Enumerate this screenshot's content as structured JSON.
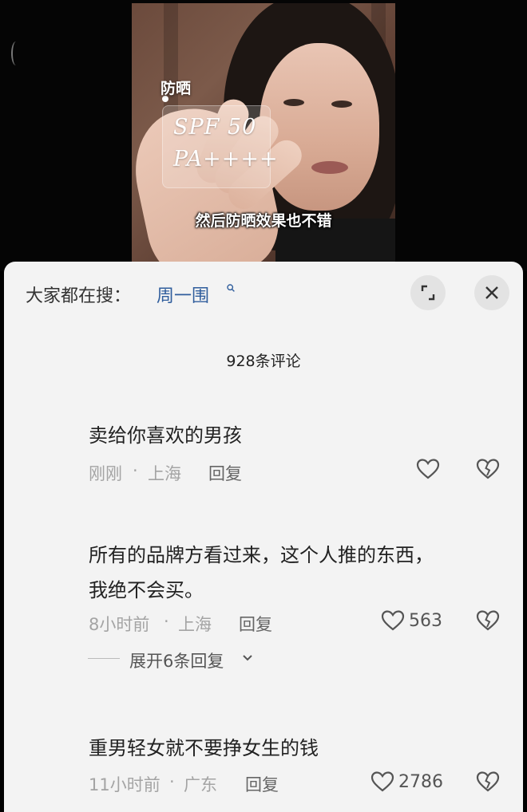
{
  "video": {
    "overlay_title": "防晒",
    "overlay_spf": "SPF 50",
    "overlay_pa": "PA++++",
    "caption": "然后防晒效果也不错"
  },
  "panel": {
    "search_prefix": "大家都在搜：",
    "search_term": "周一围",
    "icons": {
      "search": "search-icon",
      "expand": "expand-icon",
      "close": "close-icon"
    },
    "comment_count": "928条评论"
  },
  "comments": [
    {
      "text": "卖给你喜欢的男孩",
      "time": "刚刚",
      "location": "上海",
      "reply": "回复",
      "likes": ""
    },
    {
      "text_line1": "所有的品牌方看过来，这个人推的东西，",
      "text_line2": "我绝不会买。",
      "time": "8小时前",
      "location": "上海",
      "reply": "回复",
      "likes": "563",
      "expand": "展开6条回复"
    },
    {
      "text": "重男轻女就不要挣女生的钱",
      "time": "11小时前",
      "location": "广东",
      "reply": "回复",
      "likes": "2786"
    }
  ],
  "colors": {
    "link": "#2f5d9c",
    "panel_bg": "#f3f3f3",
    "meta": "#a4a4a4"
  }
}
